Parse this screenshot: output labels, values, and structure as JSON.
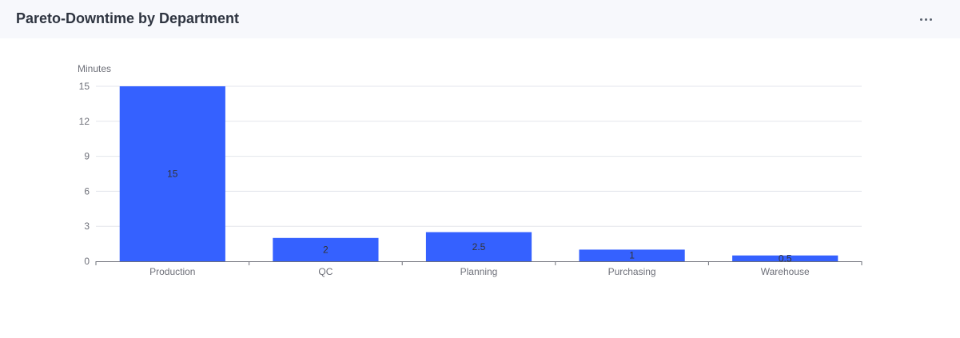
{
  "panel": {
    "title": "Pareto-Downtime by Department",
    "more_icon": "more-horizontal-icon"
  },
  "colors": {
    "bar": "#3561ff",
    "gridline": "#e3e6ec",
    "axis": "#6e7079",
    "label": "#333333"
  },
  "chart_data": {
    "type": "bar",
    "title": "Pareto-Downtime by Department",
    "xlabel": "",
    "ylabel": "Minutes",
    "categories": [
      "Production",
      "QC",
      "Planning",
      "Purchasing",
      "Warehouse"
    ],
    "values": [
      15,
      2,
      2.5,
      1,
      0.5
    ],
    "data_labels": [
      "15",
      "2",
      "2.5",
      "1",
      "0.5"
    ],
    "yticks": [
      0,
      3,
      6,
      9,
      12,
      15
    ],
    "ylim": [
      0,
      15
    ],
    "grid": true,
    "legend": false
  }
}
